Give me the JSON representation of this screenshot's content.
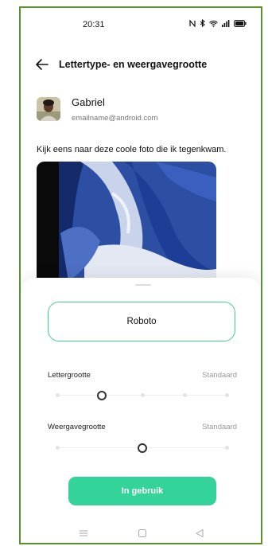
{
  "status_bar": {
    "time": "20:31",
    "icons": [
      "nfc-icon",
      "bluetooth-icon",
      "wifi-icon",
      "signal-icon",
      "battery-icon"
    ]
  },
  "header": {
    "title": "Lettertype- en weergavegrootte",
    "back_icon": "arrow-left-icon"
  },
  "message": {
    "sender_name": "Gabriel",
    "sender_email": "emailname@android.com",
    "text": "Kijk eens naar deze coole foto die ik tegenkwam."
  },
  "sheet": {
    "font_name": "Roboto",
    "font_size": {
      "label": "Lettergrootte",
      "value": "Standaard",
      "level": 2,
      "steps": 5
    },
    "display_size": {
      "label": "Weergavegrootte",
      "value": "Standaard",
      "level": 2,
      "steps": 3
    },
    "apply_label": "In gebruik"
  },
  "colors": {
    "accent": "#34d399",
    "frame": "#5b8f2f"
  },
  "nav": {
    "icons": [
      "menu-icon",
      "home-icon",
      "back-triangle-icon"
    ]
  }
}
